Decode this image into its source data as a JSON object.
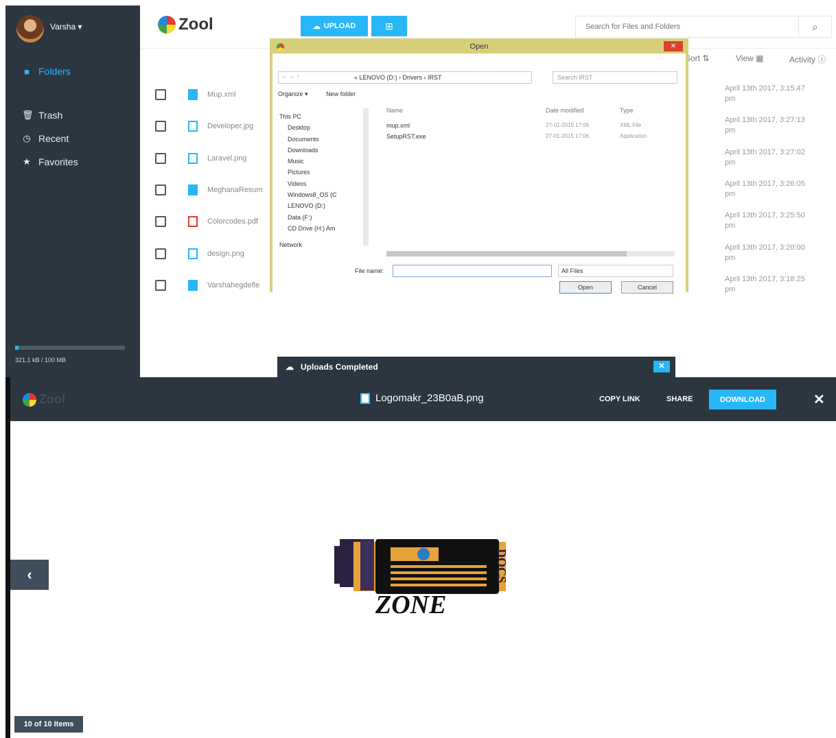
{
  "sidebar": {
    "user_name": "Varsha ▾",
    "items": [
      {
        "label": "Folders",
        "icon": "folder-icon"
      },
      {
        "label": "Trash",
        "icon": "trash-icon"
      },
      {
        "label": "Recent",
        "icon": "clock-icon"
      },
      {
        "label": "Favorites",
        "icon": "star-icon"
      }
    ],
    "storage": "321.1 kB / 100 MB"
  },
  "header": {
    "logo_text": "Zool",
    "upload_label": "UPLOAD",
    "search_placeholder": "Search for Files and Folders"
  },
  "toolbar": {
    "sort": "Sort",
    "view": "View",
    "activity": "Activity"
  },
  "files": [
    {
      "name": "Mup.xml",
      "type": "doc",
      "date": "April 13th 2017, 3:15:47",
      "ampm": "pm"
    },
    {
      "name": "Developer.jpg",
      "type": "img",
      "date": "April 13th 2017, 3:27:13",
      "ampm": "pm"
    },
    {
      "name": "Laravel.png",
      "type": "img",
      "date": "April 13th 2017, 3:27:02",
      "ampm": "pm"
    },
    {
      "name": "MeghanaResum",
      "type": "doc",
      "date": "April 13th 2017, 3:26:05",
      "ampm": "pm"
    },
    {
      "name": "Colorcodes.pdf",
      "type": "pdf",
      "date": "April 13th 2017, 3:25:50",
      "ampm": "pm"
    },
    {
      "name": "design.png",
      "type": "img",
      "date": "April 13th 2017, 3:20:00",
      "ampm": "pm"
    },
    {
      "name": "Varshahegdefle",
      "type": "doc",
      "date": "April 13th 2017, 3:18:25",
      "ampm": "pm"
    }
  ],
  "dialog": {
    "title": "Open",
    "address": "« LENOVO (D:) › Drivers › IRST",
    "search": "Search IRST",
    "organize": "Organize ▾",
    "new_folder": "New folder",
    "tree": [
      "This PC",
      "Desktop",
      "Documents",
      "Downloads",
      "Music",
      "Pictures",
      "Videos",
      "Windows8_OS (C",
      "LENOVO (D:)",
      "Data (F:)",
      "CD Drive (H:) Am",
      "Network"
    ],
    "columns": {
      "name": "Name",
      "date": "Date modified",
      "type": "Type"
    },
    "entries": [
      {
        "name": "mup.xml",
        "date": "27-01-2015 17:06",
        "type": "XML File"
      },
      {
        "name": "SetupRST.exe",
        "date": "27-01-2015 17:06",
        "type": "Application"
      }
    ],
    "file_name_label": "File name:",
    "file_type": "All Files",
    "open_label": "Open",
    "cancel_label": "Cancel"
  },
  "upload_bar": {
    "text": "Uploads Completed"
  },
  "viewer": {
    "logo_text": "Zool",
    "title": "Logomakr_23B0aB.png",
    "copy_link": "COPY LINK",
    "share": "SHARE",
    "download": "DOWNLOAD",
    "counter": "10 of 10 Items"
  },
  "preview_image": {
    "word1": "DOCS",
    "word2": "ZONE"
  },
  "colors": {
    "accent": "#29b6f6",
    "dark": "#2b3640",
    "danger": "#e53935"
  }
}
